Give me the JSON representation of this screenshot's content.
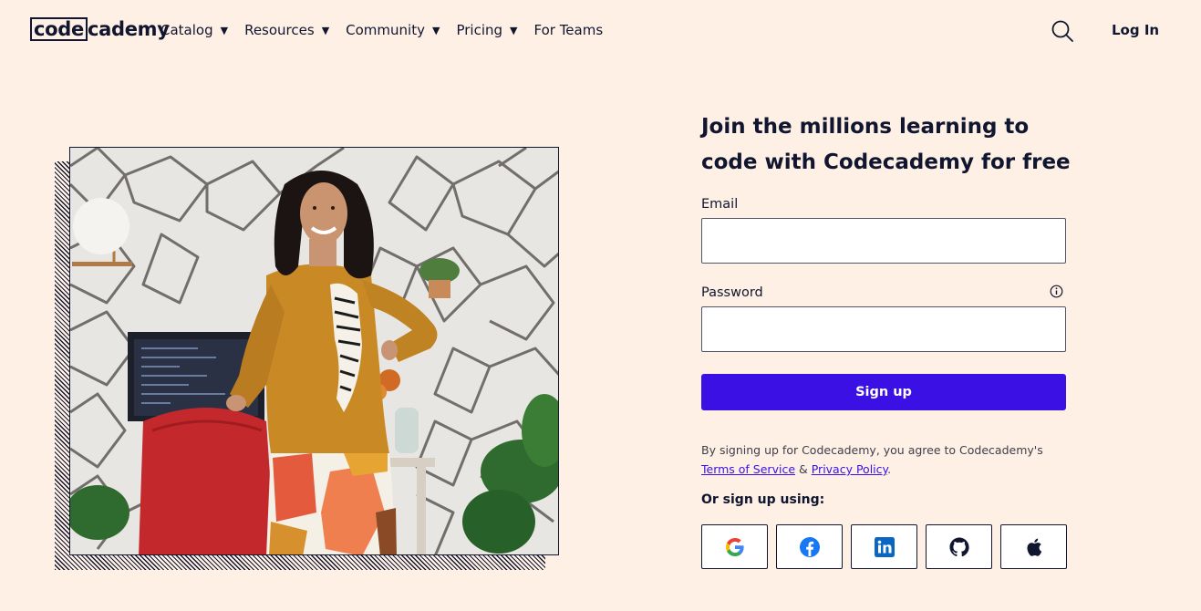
{
  "header": {
    "logo_boxed": "code",
    "logo_rest": "cademy",
    "nav": [
      {
        "label": "Catalog",
        "caret": "▼"
      },
      {
        "label": "Resources",
        "caret": "▼"
      },
      {
        "label": "Community",
        "caret": "▼"
      },
      {
        "label": "Pricing",
        "caret": "▼"
      },
      {
        "label": "For Teams",
        "caret": ""
      }
    ],
    "search_icon": "search-icon",
    "login_label": "Log In"
  },
  "form": {
    "headline": "Join the millions learning to code with Codecademy for free",
    "email_label": "Email",
    "email_value": "",
    "password_label": "Password",
    "password_value": "",
    "info_icon": "info-icon",
    "signup_label": "Sign up",
    "terms_prefix": "By signing up for Codecademy, you agree to Codecademy's",
    "terms_link": "Terms of Service",
    "terms_amp": "&",
    "privacy_link": "Privacy Policy",
    "terms_suffix": ".",
    "or_label": "Or sign up using:",
    "social": [
      "google-icon",
      "facebook-icon",
      "linkedin-icon",
      "github-icon",
      "apple-icon"
    ]
  },
  "colors": {
    "background": "#fff0e5",
    "text": "#10162f",
    "primary": "#3a10e5"
  }
}
